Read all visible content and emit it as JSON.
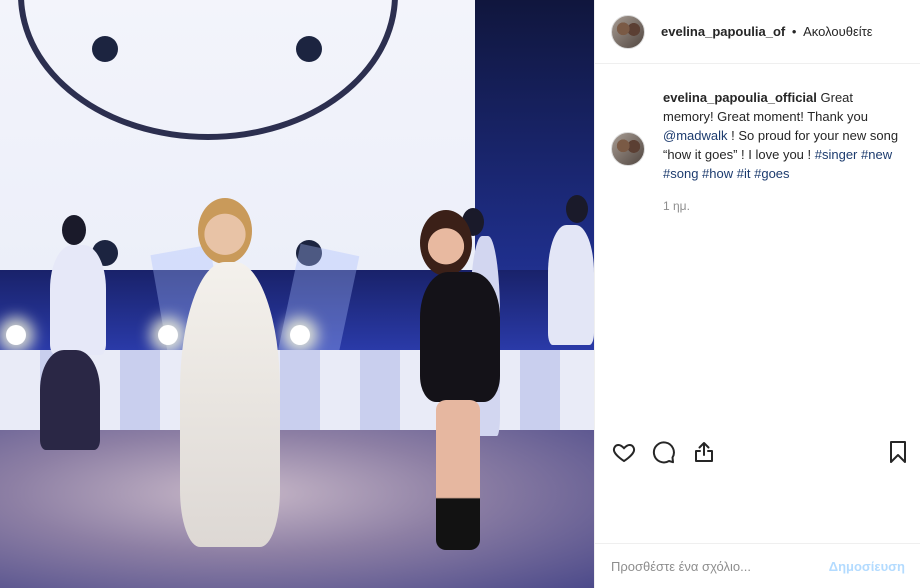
{
  "post": {
    "image_alt": "Two singers performing on a stage with dancers"
  },
  "header": {
    "username": "evelina_papoulia_of",
    "separator": "•",
    "follow_status": "Ακολουθείτε"
  },
  "caption": {
    "username": "evelina_papoulia_official",
    "text_1": " Great memory! Great moment! Thank you ",
    "mention": "@madwalk",
    "text_2": " ! So proud for your new song “how it goes” ! I love you ! ",
    "hashtags": [
      "#singer",
      "#new",
      "#song",
      "#how",
      "#it",
      "#goes"
    ],
    "time": "1 ημ."
  },
  "actions": {
    "like": "heart-icon",
    "comment": "comment-bubble-icon",
    "share": "share-icon",
    "save": "bookmark-icon"
  },
  "comment_box": {
    "placeholder": "Προσθέστε ένα σχόλιο...",
    "post_label": "Δημοσίευση"
  },
  "colors": {
    "link": "#1c3b6e",
    "post_button_disabled": "#b3dbff",
    "muted": "#8e8e8e"
  }
}
